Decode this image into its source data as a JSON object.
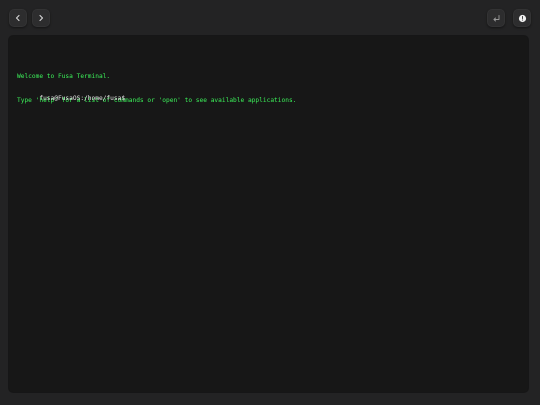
{
  "toolbar": {
    "back_icon": "chevron-left-icon",
    "forward_icon": "chevron-right-icon",
    "return_icon": "return-arrow-icon",
    "info_icon": "info-circle-icon"
  },
  "terminal": {
    "welcome_line": "Welcome to Fusa Terminal.",
    "help_line": "Type 'help' for a list of commands or 'open' to see available applications.",
    "prompt": "fusa@FusaOS:/home/fusa$",
    "input_value": ""
  },
  "colors": {
    "background": "#232324",
    "terminal_bg": "#171717",
    "output_green": "#3cf25a",
    "prompt_text": "#e6e6e6"
  }
}
